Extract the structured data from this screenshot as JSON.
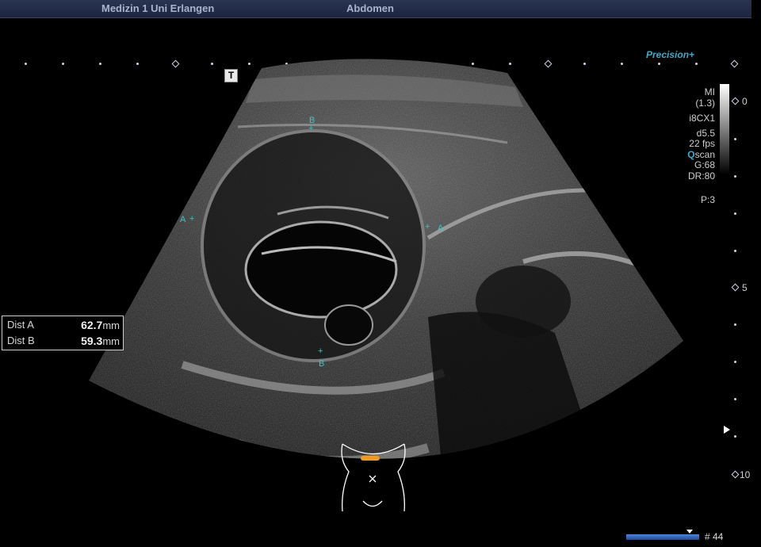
{
  "header": {
    "institution": "Medizin 1 Uni Erlangen",
    "preset": "Abdomen"
  },
  "branding": {
    "precision": "Precision+"
  },
  "marker": {
    "t_label": "T"
  },
  "parameters": {
    "mi_label": "MI",
    "mi_value": "(1.3)",
    "probe": "i8CX1",
    "depth": "d5.5",
    "fps": "22 fps",
    "qscan_q": "Q",
    "qscan_rest": "scan",
    "gain": "G:68",
    "dr": "DR:80",
    "persistence": "P:3"
  },
  "depth_scale": {
    "d0": "0",
    "d5": "5",
    "d10": "10"
  },
  "measurements": [
    {
      "label": "Dist A",
      "value": "62.7",
      "unit": "mm"
    },
    {
      "label": "Dist B",
      "value": "59.3",
      "unit": "mm"
    }
  ],
  "calipers": {
    "a": "A",
    "b": "B",
    "plus": "+"
  },
  "footer": {
    "frame": "# 44"
  },
  "colors": {
    "caliper": "#39c6c6",
    "accent": "#3fa9c8",
    "bodymarker": "#f29a1e"
  }
}
